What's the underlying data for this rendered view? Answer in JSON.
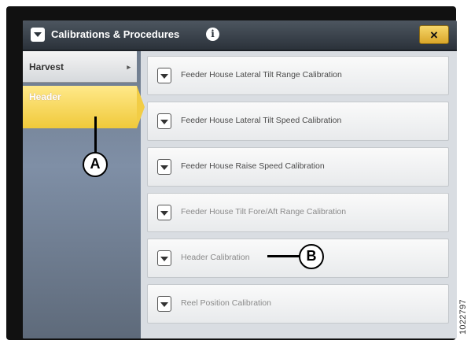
{
  "window": {
    "title": "Calibrations & Procedures",
    "close_label": "×",
    "info_label": "i"
  },
  "sidebar": {
    "items": [
      {
        "label": "Harvest",
        "arrow": "▸",
        "selected": false
      },
      {
        "label": "Header",
        "selected": true
      }
    ]
  },
  "procedures": [
    {
      "label": "Feeder House Lateral Tilt Range Calibration"
    },
    {
      "label": "Feeder House Lateral Tilt Speed Calibration"
    },
    {
      "label": "Feeder House Raise Speed Calibration"
    },
    {
      "label": "Feeder House Tilt Fore/Aft Range Calibration"
    },
    {
      "label": "Header Calibration"
    },
    {
      "label": "Reel Position Calibration"
    }
  ],
  "callouts": {
    "a": "A",
    "b": "B"
  },
  "document_number": "1022797",
  "colors": {
    "selected_tab": "#f0c93a",
    "titlebar": "#2b323a",
    "close_button": "#e4b53a"
  }
}
